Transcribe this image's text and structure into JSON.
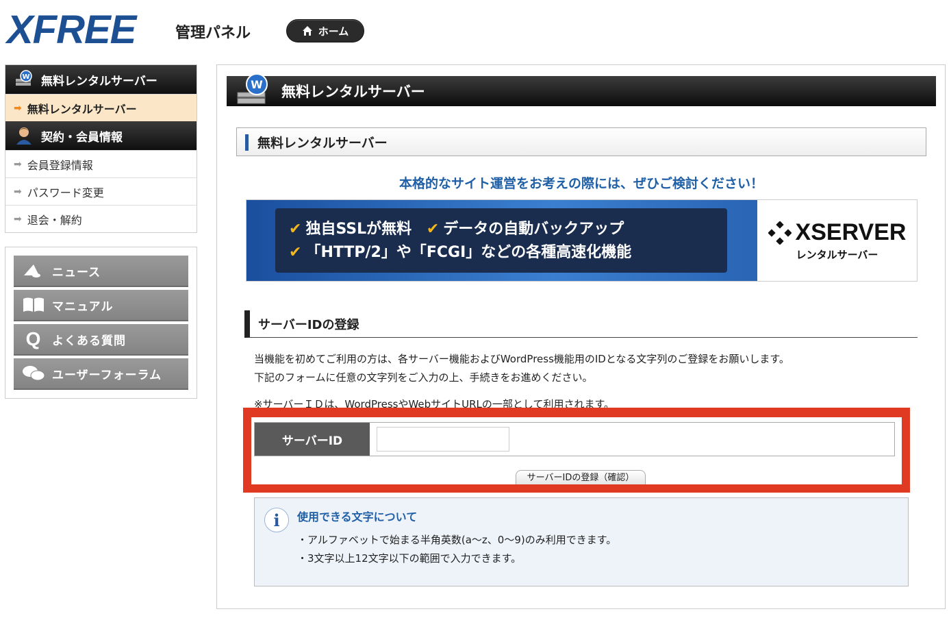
{
  "header": {
    "logo": "XFREE",
    "panel_label": "管理パネル",
    "home_label": "ホーム"
  },
  "sidebar": {
    "sections": [
      {
        "title": "無料レンタルサーバー",
        "icon": "wordpress-server-icon",
        "items": [
          {
            "label": "無料レンタルサーバー",
            "active": true
          }
        ]
      },
      {
        "title": "契約・会員情報",
        "icon": "user-icon",
        "items": [
          {
            "label": "会員登録情報"
          },
          {
            "label": "パスワード変更"
          },
          {
            "label": "退会・解約"
          }
        ]
      }
    ],
    "nav": [
      {
        "label": "ニュース",
        "icon": "megaphone-icon"
      },
      {
        "label": "マニュアル",
        "icon": "book-icon"
      },
      {
        "label": "よくある質問",
        "icon": "q-icon"
      },
      {
        "label": "ユーザーフォーラム",
        "icon": "chat-icon"
      }
    ]
  },
  "main": {
    "title": "無料レンタルサーバー",
    "subtitle": "無料レンタルサーバー",
    "promo_title": "本格的なサイト運営をお考えの際には、ぜひご検討ください！",
    "banner": {
      "line1a": "独自SSLが無料",
      "line1b": "データの自動バックアップ",
      "line2": "「HTTP/2」や「FCGI」などの各種高速化機能",
      "brand": "XSERVER",
      "brand_sub": "レンタルサーバー"
    },
    "section_title": "サーバーIDの登録",
    "desc_line1": "当機能を初めてご利用の方は、各サーバー機能およびWordPress機能用のIDとなる文字列のご登録をお願いします。",
    "desc_line2": "下記のフォームに任意の文字列をご入力の上、手続きをお進めください。",
    "note": "※サーバーＩＤは、WordPressやWebサイトURLの一部として利用されます。",
    "form": {
      "label": "サーバーID",
      "value": "",
      "placeholder": "",
      "submit": "サーバーIDの登録（確認）"
    },
    "info": {
      "title": "使用できる文字について",
      "items": [
        "・アルファベットで始まる半角英数(a〜z、0〜9)のみ利用できます。",
        "・3文字以上12文字以下の範囲で入力できます。"
      ]
    }
  },
  "colors": {
    "logo": "#1d4f93",
    "accent_blue": "#1f5fa6",
    "highlight": "#e03a22",
    "active_bg": "#fbe7c8"
  }
}
